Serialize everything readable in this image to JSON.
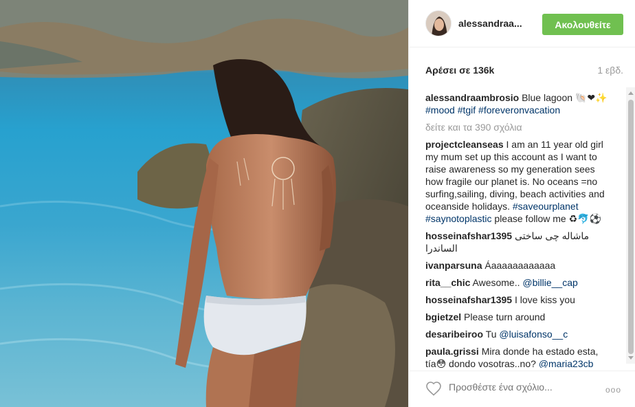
{
  "post": {
    "username": "alessandraa...",
    "follow_label": "Ακολουθείτε",
    "likes": "Αρέσει σε 136k",
    "time": "1 εβδ."
  },
  "caption": {
    "user": "alessandraambrosio",
    "text": "Blue lagoon 🐚❤✨",
    "hashtags": "#mood #tgif #foreveronvacation"
  },
  "view_all_label": "δείτε και τα 390 σχόλια",
  "comments": [
    {
      "user": "projectcleanseas",
      "text": "I am an 11 year old girl my mum set up this account as I want to raise awareness so my generation sees how fragile our planet is. No oceans =no surfing,sailing, diving, beach activities and oceanside holidays.",
      "link": "#saveourplanet #saynotoplastic",
      "tail": "please follow me ♻🐬⚽"
    },
    {
      "user": "hosseinafshar1395",
      "text": "ماشاله چی ساختی الساندرا",
      "link": "",
      "tail": ""
    },
    {
      "user": "ivanparsuna",
      "text": "Áaaaaaaaaaaaa",
      "link": "",
      "tail": ""
    },
    {
      "user": "rita__chic",
      "text": "Awesome..",
      "link": "@billie__cap",
      "tail": ""
    },
    {
      "user": "hosseinafshar1395",
      "text": "I love kiss you",
      "link": "",
      "tail": ""
    },
    {
      "user": "bgietzel",
      "text": "Please turn around",
      "link": "",
      "tail": ""
    },
    {
      "user": "desaribeiroo",
      "text": "Tu",
      "link": "@luisafonso__c",
      "tail": ""
    },
    {
      "user": "paula.grissi",
      "text": "Mira donde ha estado esta, tía😳 dondo vosotras..no?",
      "link": "@maria23cb",
      "tail": ""
    }
  ],
  "footer": {
    "add_comment_placeholder": "Προσθέστε ένα σχόλιο...",
    "more_label": "ooo"
  },
  "icons": {
    "heart": "heart-icon",
    "more": "more-options-icon"
  },
  "colors": {
    "follow_button": "#70c050",
    "link": "#003569",
    "muted": "#999999"
  }
}
